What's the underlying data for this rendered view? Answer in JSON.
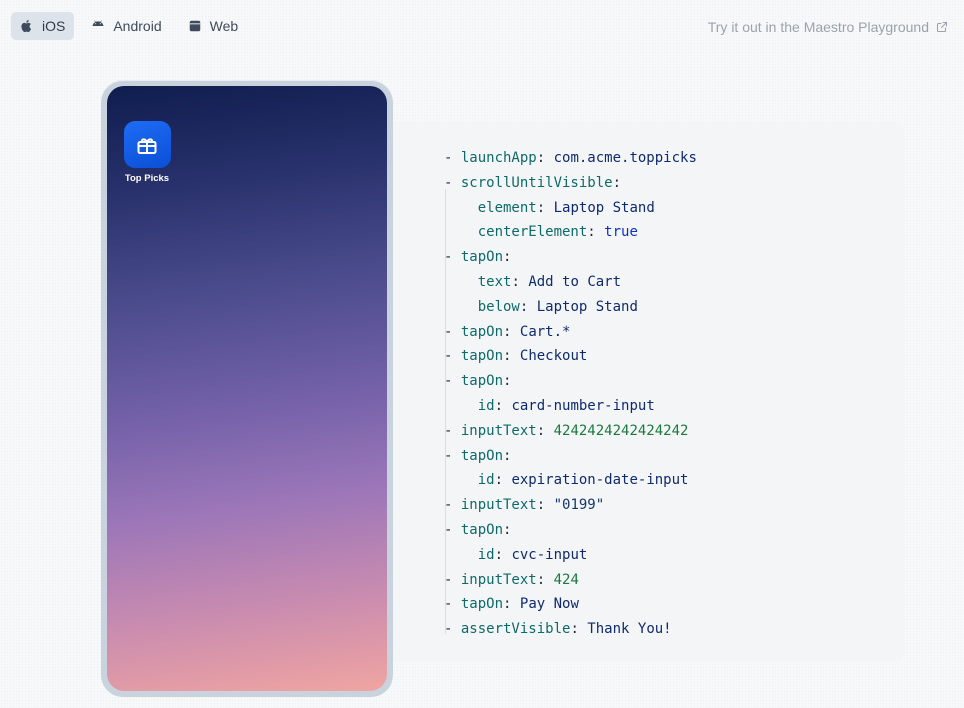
{
  "tabs": [
    {
      "label": "iOS",
      "icon": "apple-icon",
      "active": true
    },
    {
      "label": "Android",
      "icon": "android-icon",
      "active": false
    },
    {
      "label": "Web",
      "icon": "browser-icon",
      "active": false
    }
  ],
  "playground_link": {
    "label": "Try it out in the Maestro Playground",
    "icon": "external-link-icon"
  },
  "phone": {
    "app": {
      "label": "Top Picks",
      "icon": "gift-box-icon",
      "color": "#1a66f0"
    }
  },
  "code": {
    "lines": [
      {
        "key": "launchApp",
        "value": "com.acme.toppicks"
      },
      {
        "key": "scrollUntilVisible",
        "value": ""
      },
      {
        "key": "element",
        "value": "Laptop Stand",
        "nested": true
      },
      {
        "key": "centerElement",
        "value": "true",
        "nested": true
      },
      {
        "key": "tapOn",
        "value": ""
      },
      {
        "key": "text",
        "value": "Add to Cart",
        "nested": true
      },
      {
        "key": "below",
        "value": "Laptop Stand",
        "nested": true
      },
      {
        "key": "tapOn",
        "value": "Cart.*"
      },
      {
        "key": "tapOn",
        "value": "Checkout"
      },
      {
        "key": "tapOn",
        "value": ""
      },
      {
        "key": "id",
        "value": "card-number-input",
        "nested": true
      },
      {
        "key": "inputText",
        "value": "4242424242424242"
      },
      {
        "key": "tapOn",
        "value": ""
      },
      {
        "key": "id",
        "value": "expiration-date-input",
        "nested": true
      },
      {
        "key": "inputText",
        "value": "\"0199\""
      },
      {
        "key": "tapOn",
        "value": ""
      },
      {
        "key": "id",
        "value": "cvc-input",
        "nested": true
      },
      {
        "key": "inputText",
        "value": "424"
      },
      {
        "key": "tapOn",
        "value": "Pay Now"
      },
      {
        "key": "assertVisible",
        "value": "Thank You!"
      }
    ]
  }
}
